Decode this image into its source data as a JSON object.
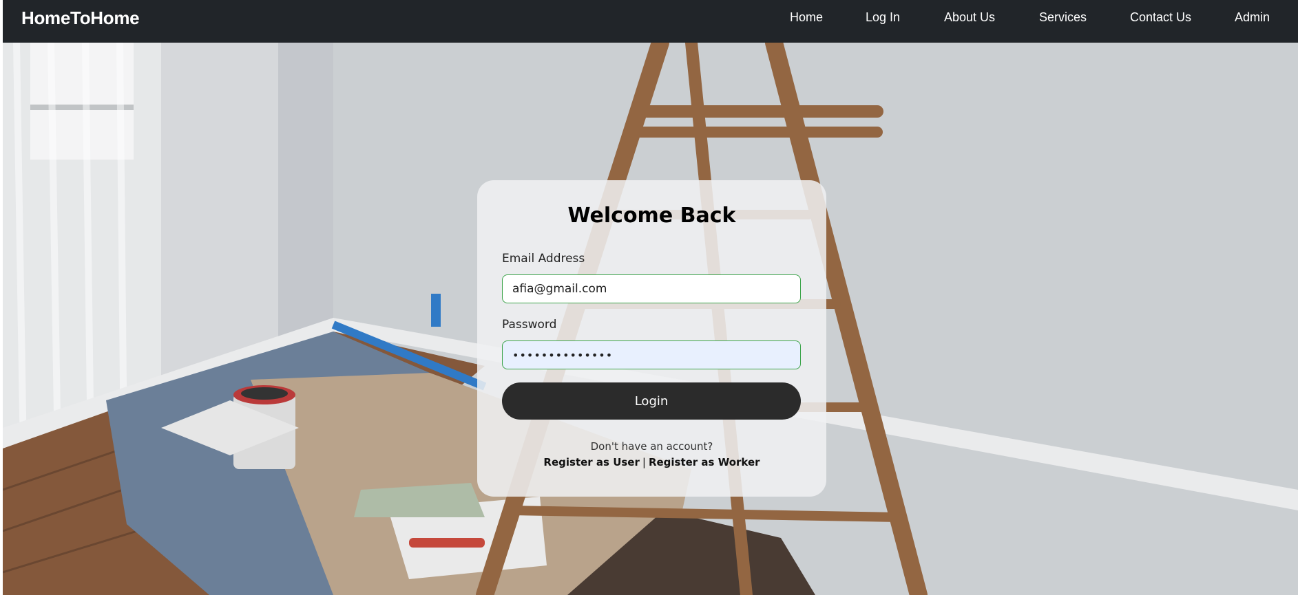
{
  "navbar": {
    "brand": "HomeToHome",
    "items": [
      {
        "label": "Home"
      },
      {
        "label": "Log In"
      },
      {
        "label": "About Us"
      },
      {
        "label": "Services"
      },
      {
        "label": "Contact Us"
      },
      {
        "label": "Admin"
      }
    ],
    "background": "#212529"
  },
  "login": {
    "title": "Welcome Back",
    "email_label": "Email Address",
    "email_value": "afia@gmail.com",
    "password_label": "Password",
    "password_value": "••••••••••••••",
    "button_label": "Login",
    "no_account_text": "Don't have an account?",
    "register_user": "Register as User",
    "separator": "|",
    "register_worker": "Register as Worker"
  },
  "colors": {
    "accent_border": "#3aa348",
    "button_bg": "#2b2b2b",
    "autofill_bg": "#e8f0fe"
  }
}
